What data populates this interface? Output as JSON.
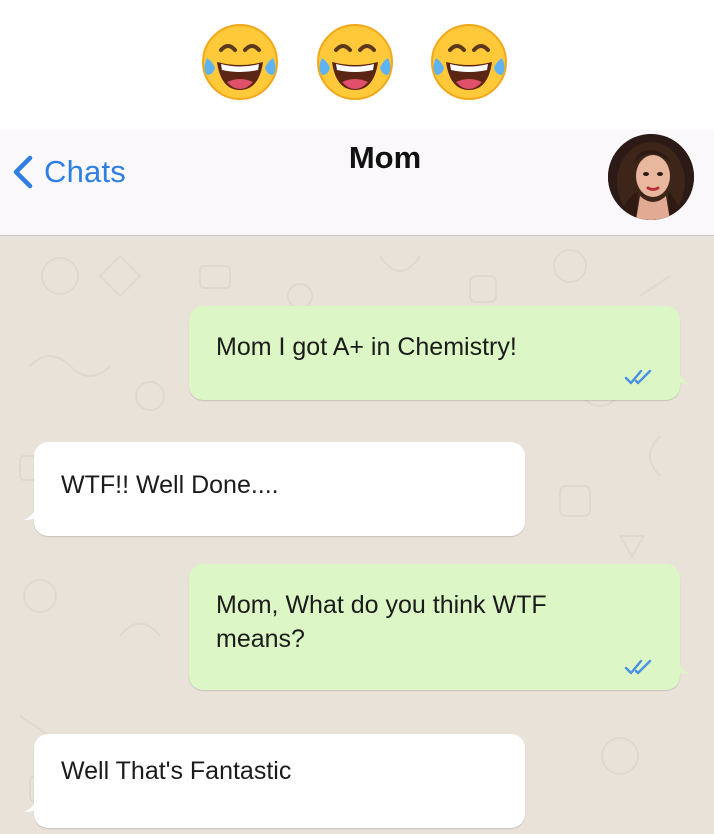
{
  "emojis": [
    {
      "icon": "face-with-tears-of-joy-icon"
    },
    {
      "icon": "face-with-tears-of-joy-icon"
    },
    {
      "icon": "face-with-tears-of-joy-icon"
    }
  ],
  "header": {
    "back_label": "Chats",
    "back_icon": "chevron-left-icon",
    "title": "Mom",
    "avatar_icon": "contact-avatar"
  },
  "colors": {
    "accent": "#2f7fe0",
    "outgoing_bubble": "#dcf7c5",
    "incoming_bubble": "#ffffff",
    "chat_background": "#e8e2d9",
    "read_ticks": "#4a90e2"
  },
  "messages": [
    {
      "direction": "outgoing",
      "text": "Mom I got A+ in Chemistry!",
      "status_icon": "double-check-icon"
    },
    {
      "direction": "incoming",
      "text": "WTF!! Well Done...."
    },
    {
      "direction": "outgoing",
      "text": "Mom, What do you think WTF means?",
      "status_icon": "double-check-icon"
    },
    {
      "direction": "incoming",
      "text": "Well That's Fantastic"
    }
  ]
}
